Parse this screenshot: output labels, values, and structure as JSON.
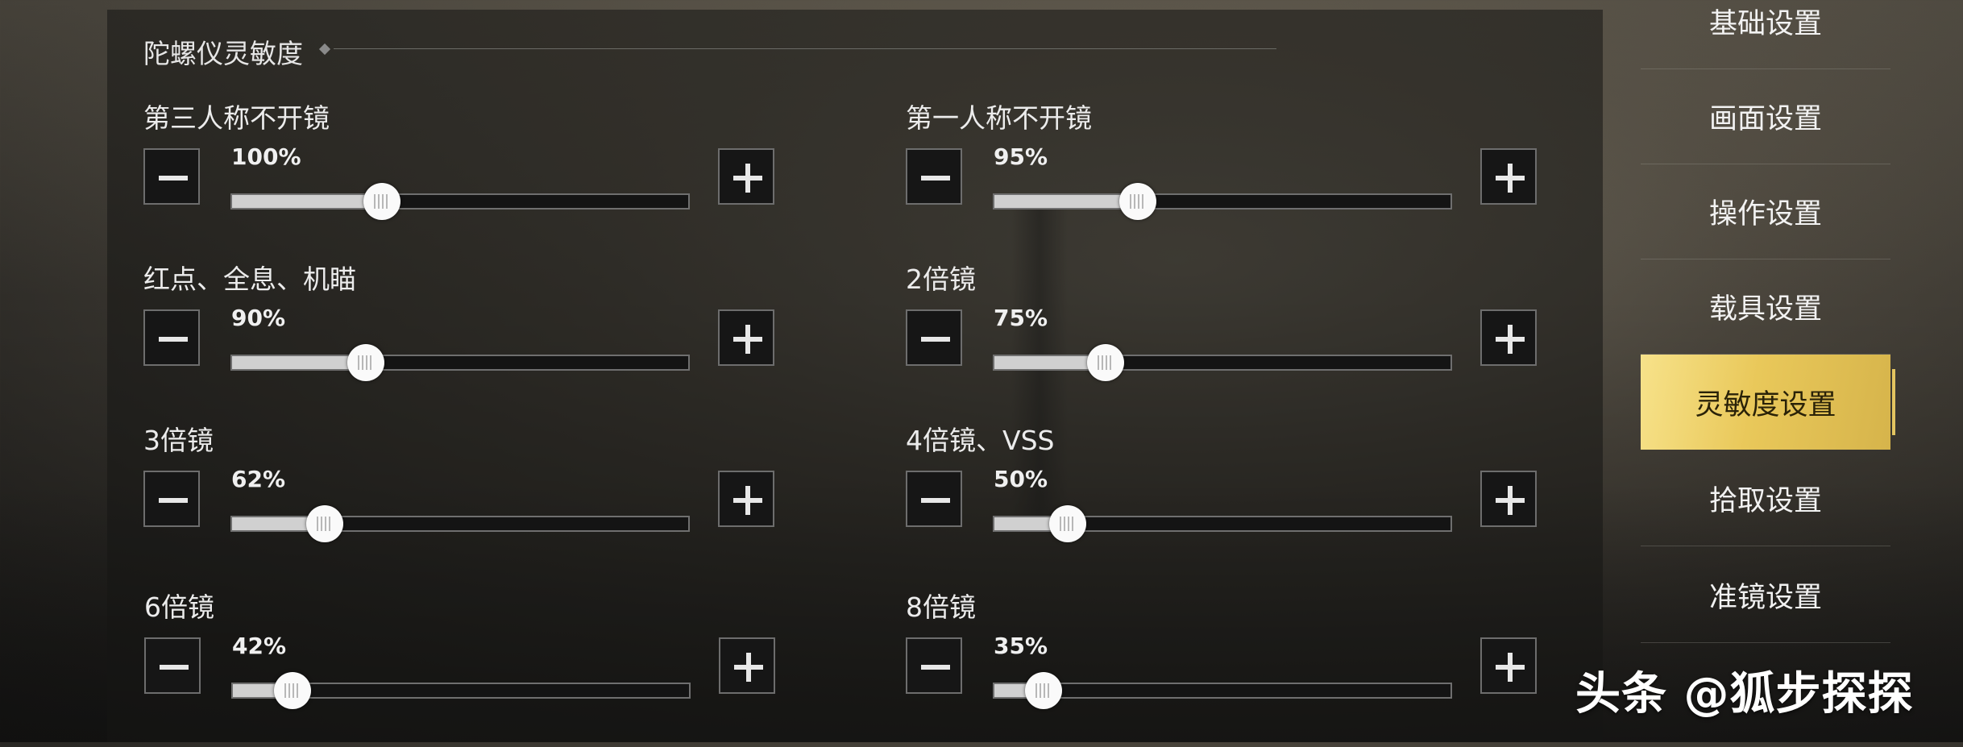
{
  "section_title": "陀螺仪灵敏度",
  "sliders": [
    {
      "label": "第三人称不开镜",
      "value_text": "100%",
      "fraction": 0.33
    },
    {
      "label": "第一人称不开镜",
      "value_text": "95%",
      "fraction": 0.315
    },
    {
      "label": "红点、全息、机瞄",
      "value_text": "90%",
      "fraction": 0.295
    },
    {
      "label": "2倍镜",
      "value_text": "75%",
      "fraction": 0.245
    },
    {
      "label": "3倍镜",
      "value_text": "62%",
      "fraction": 0.205
    },
    {
      "label": "4倍镜、VSS",
      "value_text": "50%",
      "fraction": 0.163
    },
    {
      "label": "6倍镜",
      "value_text": "42%",
      "fraction": 0.133
    },
    {
      "label": "8倍镜",
      "value_text": "35%",
      "fraction": 0.11
    }
  ],
  "nav": {
    "items": [
      "基础设置",
      "画面设置",
      "操作设置",
      "载具设置",
      "灵敏度设置",
      "拾取设置",
      "准镜设置"
    ],
    "active": "灵敏度设置"
  },
  "watermark": "头条 @狐步探探",
  "colors": {
    "accent_gold": "#e9c85a",
    "slider_fill": "#d0d0d0"
  },
  "icons": {
    "minus": "minus-icon",
    "plus": "plus-icon"
  }
}
